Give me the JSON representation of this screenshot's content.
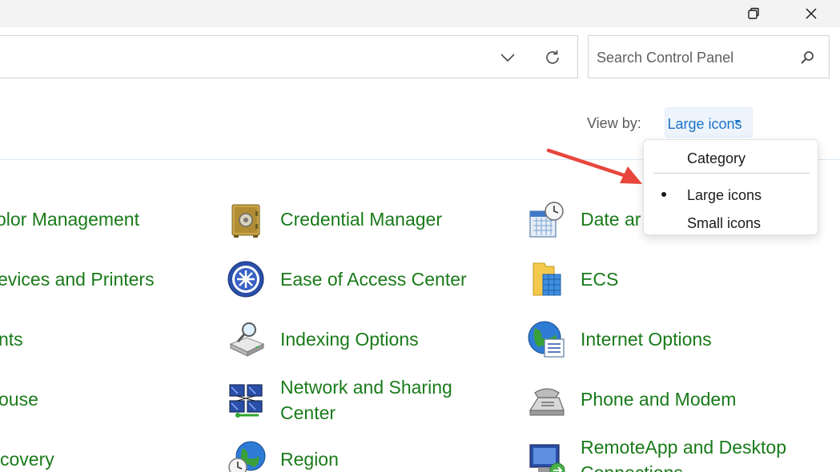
{
  "window": {
    "maximize_icon": "restore-icon",
    "close_icon": "close-icon"
  },
  "address": {
    "dropdown_icon": "chevron-down-icon",
    "refresh_icon": "refresh-icon"
  },
  "search": {
    "placeholder": "Search Control Panel",
    "icon": "search-icon"
  },
  "viewby": {
    "label": "View by:",
    "selected": "Large icons",
    "accent": "#1a73c9"
  },
  "dropdown": {
    "items": [
      {
        "label": "Category",
        "selected": false
      },
      {
        "label": "Large icons",
        "selected": true
      },
      {
        "label": "Small icons",
        "selected": false
      }
    ]
  },
  "items": {
    "col1": [
      {
        "label": "olor Management"
      },
      {
        "label": "evices and Printers"
      },
      {
        "label": "nts"
      },
      {
        "label": "ouse"
      },
      {
        "label": "covery"
      }
    ],
    "col2": [
      {
        "label": "Credential Manager",
        "icon": "safe-icon"
      },
      {
        "label": "Ease of Access Center",
        "icon": "accessibility-icon"
      },
      {
        "label": "Indexing Options",
        "icon": "indexing-icon"
      },
      {
        "label_line1": "Network and Sharing",
        "label_line2": "Center",
        "icon": "network-icon"
      },
      {
        "label": "Region",
        "icon": "globe-clock-icon"
      }
    ],
    "col3": [
      {
        "label": "Date ar",
        "icon": "calendar-clock-icon"
      },
      {
        "label": "ECS",
        "icon": "folder-cubes-icon"
      },
      {
        "label": "Internet Options",
        "icon": "globe-list-icon"
      },
      {
        "label": "Phone and Modem",
        "icon": "phone-icon"
      },
      {
        "label_line1": "RemoteApp and Desktop",
        "label_line2": "Connections",
        "icon": "remote-desktop-icon"
      }
    ]
  },
  "colors": {
    "link_green": "#1a7a1a",
    "annotation_arrow": "#e8463c"
  }
}
